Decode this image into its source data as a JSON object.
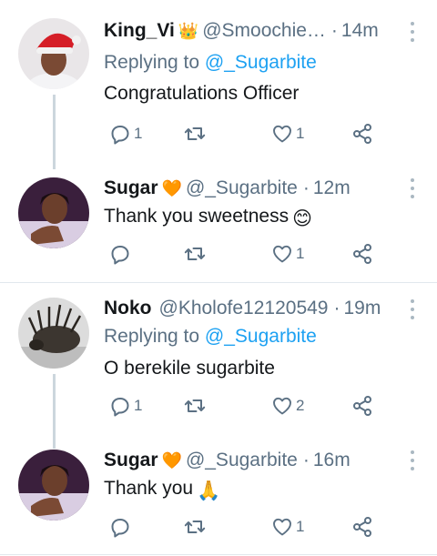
{
  "tweets": [
    {
      "name": "King_Vi",
      "badge": "👑",
      "handle": "@Smoochie…",
      "time": "14m",
      "reply_prefix": "Replying to",
      "reply_to": "@_Sugarbite",
      "text": "Congratulations Officer",
      "replies": "1",
      "retweets": "",
      "likes": "1",
      "avatar": "woman-santa-hat"
    },
    {
      "name": "Sugar",
      "badge": "🧡",
      "handle": "@_Sugarbite",
      "time": "12m",
      "text": "Thank you sweetness",
      "emoji": "😊",
      "replies": "",
      "retweets": "",
      "likes": "1",
      "avatar": "woman-portrait"
    },
    {
      "name": "Noko",
      "handle": "@Kholofe12120549",
      "time": "19m",
      "reply_prefix": "Replying to",
      "reply_to": "@_Sugarbite",
      "text": "O berekile sugarbite",
      "replies": "1",
      "retweets": "",
      "likes": "2",
      "avatar": "porcupine"
    },
    {
      "name": "Sugar",
      "badge": "🧡",
      "handle": "@_Sugarbite",
      "time": "16m",
      "text": "Thank you",
      "emoji": "🙏",
      "replies": "",
      "retweets": "",
      "likes": "1",
      "avatar": "woman-portrait"
    }
  ],
  "icons": {
    "reply": "reply-icon",
    "retweet": "retweet-icon",
    "like": "heart-icon",
    "share": "share-icon",
    "more": "more-vertical-icon"
  },
  "colors": {
    "link": "#1da1f2",
    "secondary_text": "#5b7083",
    "icon": "#5b7083",
    "divider": "#e1e8ed"
  }
}
